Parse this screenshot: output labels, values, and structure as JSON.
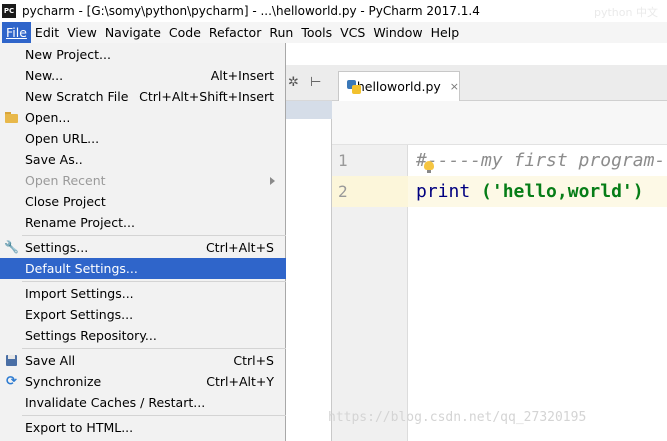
{
  "window": {
    "app_icon": "PC",
    "title": "pycharm - [G:\\somy\\python\\pycharm] - ...\\helloworld.py - PyCharm 2017.1.4"
  },
  "menubar": {
    "items": [
      {
        "label": "File",
        "active": true
      },
      {
        "label": "Edit"
      },
      {
        "label": "View"
      },
      {
        "label": "Navigate"
      },
      {
        "label": "Code"
      },
      {
        "label": "Refactor"
      },
      {
        "label": "Run"
      },
      {
        "label": "Tools"
      },
      {
        "label": "VCS"
      },
      {
        "label": "Window"
      },
      {
        "label": "Help"
      }
    ]
  },
  "file_menu": {
    "items": [
      {
        "label": "New Project...",
        "shortcut": ""
      },
      {
        "label": "New...",
        "shortcut": "Alt+Insert"
      },
      {
        "label": "New Scratch File",
        "shortcut": "Ctrl+Alt+Shift+Insert"
      },
      {
        "label": "Open...",
        "shortcut": "",
        "icon": "folder-icon"
      },
      {
        "label": "Open URL...",
        "shortcut": ""
      },
      {
        "label": "Save As..",
        "shortcut": ""
      },
      {
        "label": "Open Recent",
        "shortcut": "",
        "disabled": true,
        "submenu": true
      },
      {
        "label": "Close Project",
        "shortcut": ""
      },
      {
        "label": "Rename Project...",
        "shortcut": ""
      },
      {
        "label": "Settings...",
        "shortcut": "Ctrl+Alt+S",
        "icon": "wrench-icon"
      },
      {
        "label": "Default Settings...",
        "shortcut": "",
        "selected": true
      },
      {
        "label": "Import Settings...",
        "shortcut": ""
      },
      {
        "label": "Export Settings...",
        "shortcut": ""
      },
      {
        "label": "Settings Repository...",
        "shortcut": ""
      },
      {
        "label": "Save All",
        "shortcut": "Ctrl+S",
        "icon": "save-icon"
      },
      {
        "label": "Synchronize",
        "shortcut": "Ctrl+Alt+Y",
        "icon": "sync-icon"
      },
      {
        "label": "Invalidate Caches / Restart...",
        "shortcut": ""
      },
      {
        "label": "Export to HTML...",
        "shortcut": ""
      }
    ]
  },
  "editor": {
    "tab_label": "helloworld.py",
    "tab_close": "×",
    "toolbar_icons": [
      "gear-icon",
      "collapse-icon"
    ],
    "line_numbers": [
      "1",
      "2"
    ],
    "lines": [
      "#-----my first program-",
      "print ('hello,world')"
    ],
    "code_keyword": "print",
    "code_string": "('hello,world')"
  },
  "watermark": "https://blog.csdn.net/qq_27320195",
  "top_watermark": "python 中文",
  "colors": {
    "menu_selected": "#2f65ca",
    "menu_background": "#f2f2f2",
    "current_line": "#fdf9e6",
    "comment": "#8c8c8c",
    "string": "#067d17"
  }
}
